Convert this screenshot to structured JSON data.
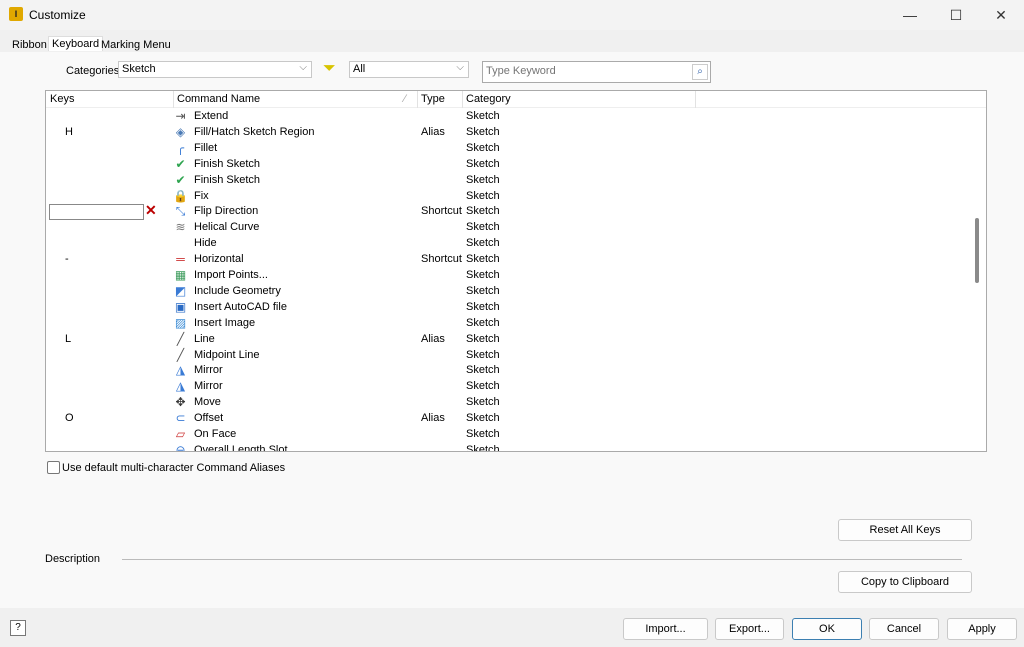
{
  "window": {
    "title": "Customize",
    "app_icon": "I"
  },
  "tabs": [
    "Ribbon",
    "Keyboard",
    "Marking Menu"
  ],
  "filters": {
    "categories_label": "Categories:",
    "categories_value": "Sketch",
    "type_value": "All",
    "search_placeholder": "Type Keyword"
  },
  "table": {
    "headers": [
      "Keys",
      "Command Name",
      "Type",
      "Category"
    ],
    "rows": [
      {
        "key": "",
        "icon": "extend-icon",
        "glyph": "⇥",
        "color": "#555",
        "name": "Extend",
        "type": "",
        "category": "Sketch"
      },
      {
        "key": "H",
        "icon": "fill-hatch-icon",
        "glyph": "◈",
        "color": "#4a7ab5",
        "name": "Fill/Hatch Sketch Region",
        "type": "Alias",
        "category": "Sketch"
      },
      {
        "key": "",
        "icon": "fillet-icon",
        "glyph": "╭",
        "color": "#3a7bd5",
        "name": "Fillet",
        "type": "",
        "category": "Sketch"
      },
      {
        "key": "",
        "icon": "checkmark-icon",
        "glyph": "✔",
        "color": "#2ea44f",
        "name": "Finish Sketch",
        "type": "",
        "category": "Sketch"
      },
      {
        "key": "",
        "icon": "checkmark-icon",
        "glyph": "✔",
        "color": "#2ea44f",
        "name": "Finish Sketch",
        "type": "",
        "category": "Sketch"
      },
      {
        "key": "",
        "icon": "lock-icon",
        "glyph": "🔒",
        "color": "#d44",
        "name": "Fix",
        "type": "",
        "category": "Sketch"
      },
      {
        "key": "",
        "icon": "flip-direction-icon",
        "glyph": "⤡",
        "color": "#3a7bd5",
        "name": "Flip Direction",
        "type": "Shortcut",
        "category": "Sketch",
        "editing": true
      },
      {
        "key": "",
        "icon": "helical-curve-icon",
        "glyph": "≋",
        "color": "#777",
        "name": "Helical Curve",
        "type": "",
        "category": "Sketch"
      },
      {
        "key": "",
        "icon": "",
        "glyph": "",
        "color": "#000",
        "name": "Hide",
        "type": "",
        "category": "Sketch"
      },
      {
        "key": "-",
        "icon": "horizontal-icon",
        "glyph": "═",
        "color": "#c33",
        "name": "Horizontal",
        "type": "Shortcut",
        "category": "Sketch"
      },
      {
        "key": "",
        "icon": "import-points-icon",
        "glyph": "▦",
        "color": "#3a9a5a",
        "name": "Import Points...",
        "type": "",
        "category": "Sketch"
      },
      {
        "key": "",
        "icon": "include-geometry-icon",
        "glyph": "◩",
        "color": "#3a7bd5",
        "name": "Include Geometry",
        "type": "",
        "category": "Sketch"
      },
      {
        "key": "",
        "icon": "autocad-file-icon",
        "glyph": "▣",
        "color": "#2a6bc5",
        "name": "Insert AutoCAD file",
        "type": "",
        "category": "Sketch"
      },
      {
        "key": "",
        "icon": "image-icon",
        "glyph": "▨",
        "color": "#3a8bd5",
        "name": "Insert Image",
        "type": "",
        "category": "Sketch"
      },
      {
        "key": "L",
        "icon": "line-icon",
        "glyph": "╱",
        "color": "#555",
        "name": "Line",
        "type": "Alias",
        "category": "Sketch"
      },
      {
        "key": "",
        "icon": "midpoint-line-icon",
        "glyph": "╱",
        "color": "#555",
        "name": "Midpoint Line",
        "type": "",
        "category": "Sketch"
      },
      {
        "key": "",
        "icon": "mirror-icon",
        "glyph": "◮",
        "color": "#3a7bd5",
        "name": "Mirror",
        "type": "",
        "category": "Sketch"
      },
      {
        "key": "",
        "icon": "mirror-icon",
        "glyph": "◮",
        "color": "#3a7bd5",
        "name": "Mirror",
        "type": "",
        "category": "Sketch"
      },
      {
        "key": "",
        "icon": "move-icon",
        "glyph": "✥",
        "color": "#333",
        "name": "Move",
        "type": "",
        "category": "Sketch"
      },
      {
        "key": "O",
        "icon": "offset-icon",
        "glyph": "⊂",
        "color": "#3a7bd5",
        "name": "Offset",
        "type": "Alias",
        "category": "Sketch"
      },
      {
        "key": "",
        "icon": "on-face-icon",
        "glyph": "▱",
        "color": "#c33",
        "name": "On Face",
        "type": "",
        "category": "Sketch"
      },
      {
        "key": "",
        "icon": "slot-icon",
        "glyph": "⊖",
        "color": "#3a7bd5",
        "name": "Overall Length Slot",
        "type": "",
        "category": "Sketch"
      }
    ]
  },
  "checkbox": {
    "label": "Use default multi-character Command Aliases",
    "checked": false
  },
  "buttons": {
    "reset": "Reset All Keys",
    "copy": "Copy to Clipboard",
    "import": "Import...",
    "export": "Export...",
    "ok": "OK",
    "cancel": "Cancel",
    "apply": "Apply"
  },
  "description_label": "Description"
}
